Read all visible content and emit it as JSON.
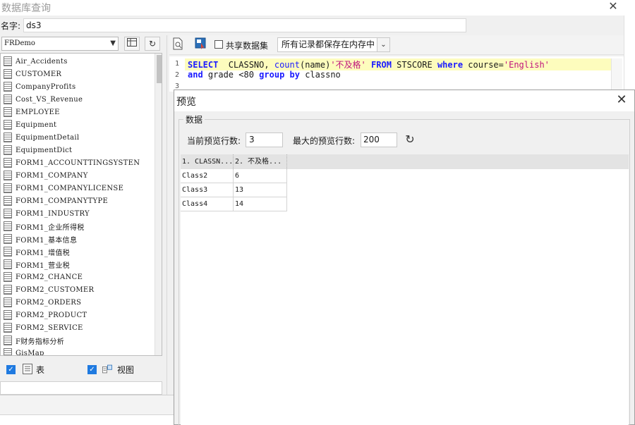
{
  "outer": {
    "title": "数据库查询",
    "close_glyph": "✕",
    "name_label": "名字:",
    "name_value": "ds3"
  },
  "left_panel": {
    "db_select": "FRDemo",
    "tree_items": [
      "Air_Accidents",
      "CUSTOMER",
      "CompanyProfits",
      "Cost_VS_Revenue",
      "EMPLOYEE",
      "Equipment",
      "EquipmentDetail",
      "EquipmentDict",
      "FORM1_ACCOUNTTINGSYSTEN",
      "FORM1_COMPANY",
      "FORM1_COMPANYLICENSE",
      "FORM1_COMPANYTYPE",
      "FORM1_INDUSTRY",
      "FORM1_企业所得税",
      "FORM1_基本信息",
      "FORM1_增值税",
      "FORM1_营业税",
      "FORM2_CHANCE",
      "FORM2_CUSTOMER",
      "FORM2_ORDERS",
      "FORM2_PRODUCT",
      "FORM2_SERVICE",
      "F财务指标分析",
      "GisMap"
    ],
    "table_label": "表",
    "view_label": "视图"
  },
  "toolbar": {
    "share_label": "共享数据集",
    "memory_select": "所有记录都保存在内存中"
  },
  "editor": {
    "line_numbers": [
      "1",
      "2",
      "3"
    ],
    "line1": {
      "kw_select": "SELECT",
      "cols": "  CLASSNO, ",
      "fn_count": "count",
      "arg": "(name)",
      "str_alias": "'不及格'",
      "kw_from": "FROM",
      "table": " STSCORE ",
      "kw_where": "where",
      "cond": " course=",
      "str_val": "'English'"
    },
    "line2": {
      "kw_and": "and",
      "cond": " grade <80 ",
      "kw_group": "group by",
      "col": " classno"
    }
  },
  "preview": {
    "title": "预览",
    "close_glyph": "✕",
    "group_label": "数据",
    "current_rows_label": "当前预览行数:",
    "current_rows_value": "3",
    "max_rows_label": "最大的预览行数:",
    "max_rows_value": "200",
    "columns": [
      "1. CLASSN...",
      "2. 不及格..."
    ],
    "rows": [
      [
        "Class2",
        "6"
      ],
      [
        "Class3",
        "13"
      ],
      [
        "Class4",
        "14"
      ]
    ]
  }
}
